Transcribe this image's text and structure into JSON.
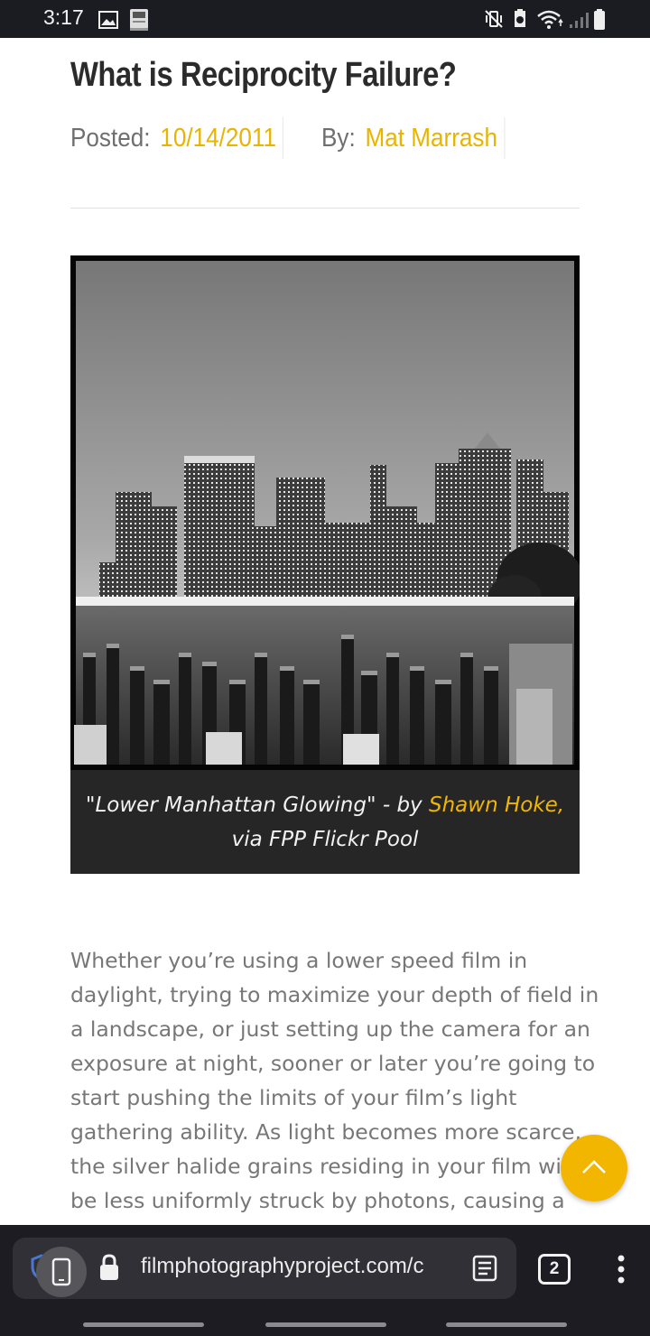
{
  "status_bar": {
    "time": "3:17",
    "left_icons": [
      "gallery-icon",
      "bible-app-icon"
    ],
    "right_icons": [
      "mute-vibrate-icon",
      "data-saver-icon",
      "wifi-icon",
      "signal-icon",
      "battery-icon"
    ]
  },
  "article": {
    "title": "What is Reciprocity Failure?",
    "posted_label": "Posted:",
    "posted_date": "10/14/2011",
    "by_label": "By:",
    "author": "Mat Marrash",
    "caption_part1": "\"Lower Manhattan Glowing\" - by ",
    "caption_link": "Shawn Hoke,",
    "caption_part2": "via FPP Flickr Pool",
    "body_lines": [
      "Whether you’re using a lower speed film in",
      "daylight, trying to maximize your depth of field in",
      "a landscape, or just setting up the camera for an",
      "exposure at night, sooner or later you’re going to",
      "start pushing the limits of your film’s light",
      "gathering ability. As light becomes more scarce,",
      "the silver halide grains residing in your film will",
      "be less uniformly struck by photons, causing a"
    ]
  },
  "scroll_top_button": {
    "icon": "chevron-up-icon"
  },
  "browser": {
    "url": "filmphotographyproject.com/c",
    "tab_count": "2",
    "icons": [
      "shield-icon",
      "lock-icon",
      "reader-mode-icon",
      "tabs-icon",
      "more-vert-icon"
    ]
  },
  "colors": {
    "accent": "#f2b600",
    "title": "#2b2b2b",
    "body_text": "#777777",
    "caption_bg": "#262626",
    "toolbar_bg": "#1c1c22"
  }
}
